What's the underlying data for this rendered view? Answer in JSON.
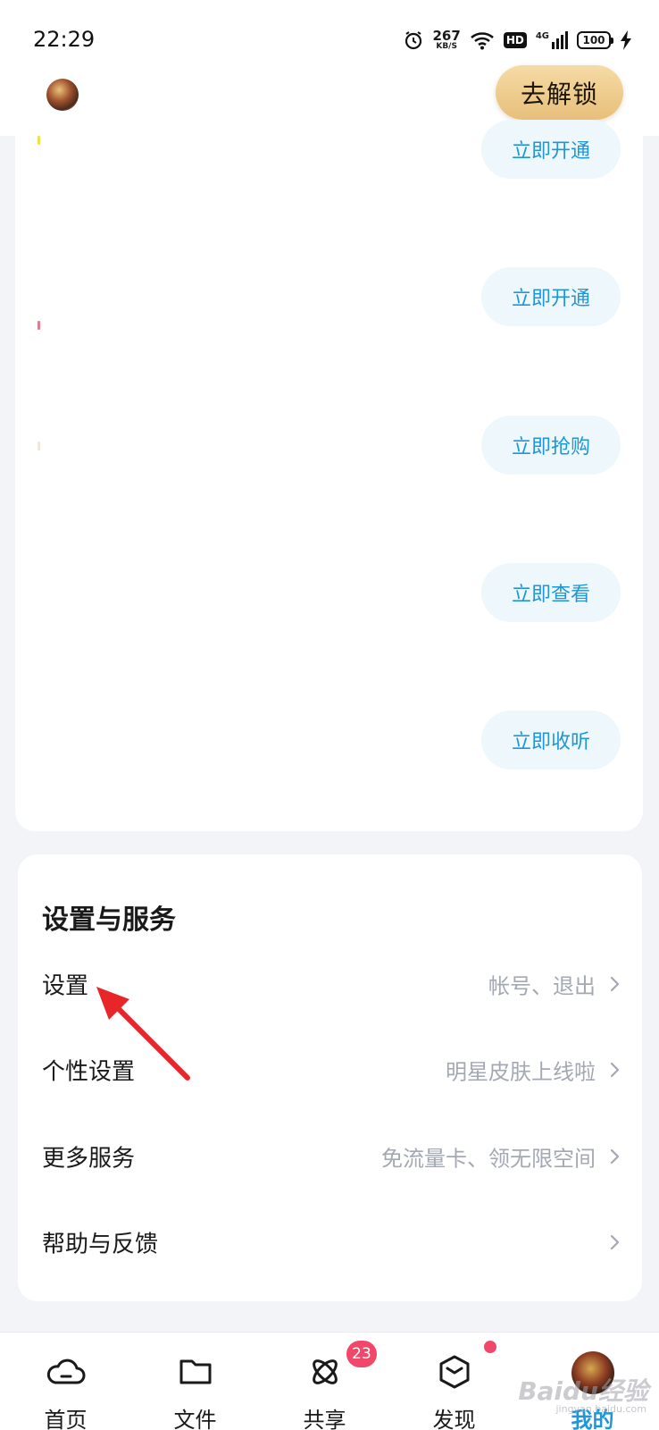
{
  "status_bar": {
    "time": "22:29",
    "net_speed_value": "267",
    "net_speed_unit": "KB/S",
    "hd": "HD",
    "network": "4G",
    "battery": "100"
  },
  "header": {
    "unlock_label": "去解锁"
  },
  "service_actions": [
    {
      "label": "立即开通"
    },
    {
      "label": "立即开通"
    },
    {
      "label": "立即抢购"
    },
    {
      "label": "立即查看"
    },
    {
      "label": "立即收听"
    }
  ],
  "settings_section": {
    "title": "设置与服务",
    "rows": [
      {
        "label": "设置",
        "hint": "帐号、退出"
      },
      {
        "label": "个性设置",
        "hint": "明星皮肤上线啦"
      },
      {
        "label": "更多服务",
        "hint": "免流量卡、领无限空间"
      },
      {
        "label": "帮助与反馈",
        "hint": ""
      }
    ]
  },
  "bottom_nav": {
    "items": [
      {
        "label": "首页",
        "icon": "cloud-home-icon"
      },
      {
        "label": "文件",
        "icon": "folder-icon"
      },
      {
        "label": "共享",
        "icon": "share-atom-icon",
        "badge": "23"
      },
      {
        "label": "发现",
        "icon": "cube-discover-icon",
        "dot": true
      },
      {
        "label": "我的",
        "icon": "avatar",
        "active": true
      }
    ]
  },
  "watermark": {
    "text": "Baidu经验",
    "sub": "jingyan.baidu.com"
  },
  "colors": {
    "accent": "#1f96d8",
    "badge": "#f0486b",
    "unlock_gold": "#e7bf7a",
    "hint_gray": "#a3a8b3",
    "annotation_arrow": "#e8262a"
  }
}
